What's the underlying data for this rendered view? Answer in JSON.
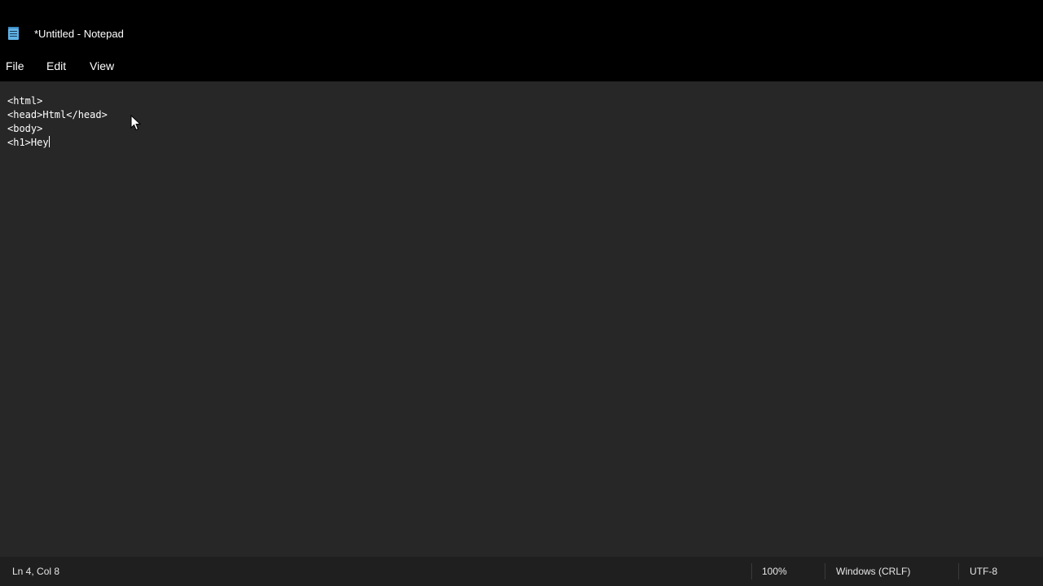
{
  "window": {
    "title": "*Untitled - Notepad",
    "app_icon": "notepad-icon"
  },
  "menu": {
    "file": "File",
    "edit": "Edit",
    "view": "View"
  },
  "editor": {
    "lines": [
      "<html>",
      "<head>Html</head>",
      "<body>",
      "<h1>Hey"
    ],
    "background": "#272727",
    "text_color": "#ffffff"
  },
  "cursor": {
    "icon": "mouse-pointer-icon"
  },
  "statusbar": {
    "position": "Ln 4, Col 8",
    "zoom": "100%",
    "line_ending": "Windows (CRLF)",
    "encoding": "UTF-8"
  }
}
